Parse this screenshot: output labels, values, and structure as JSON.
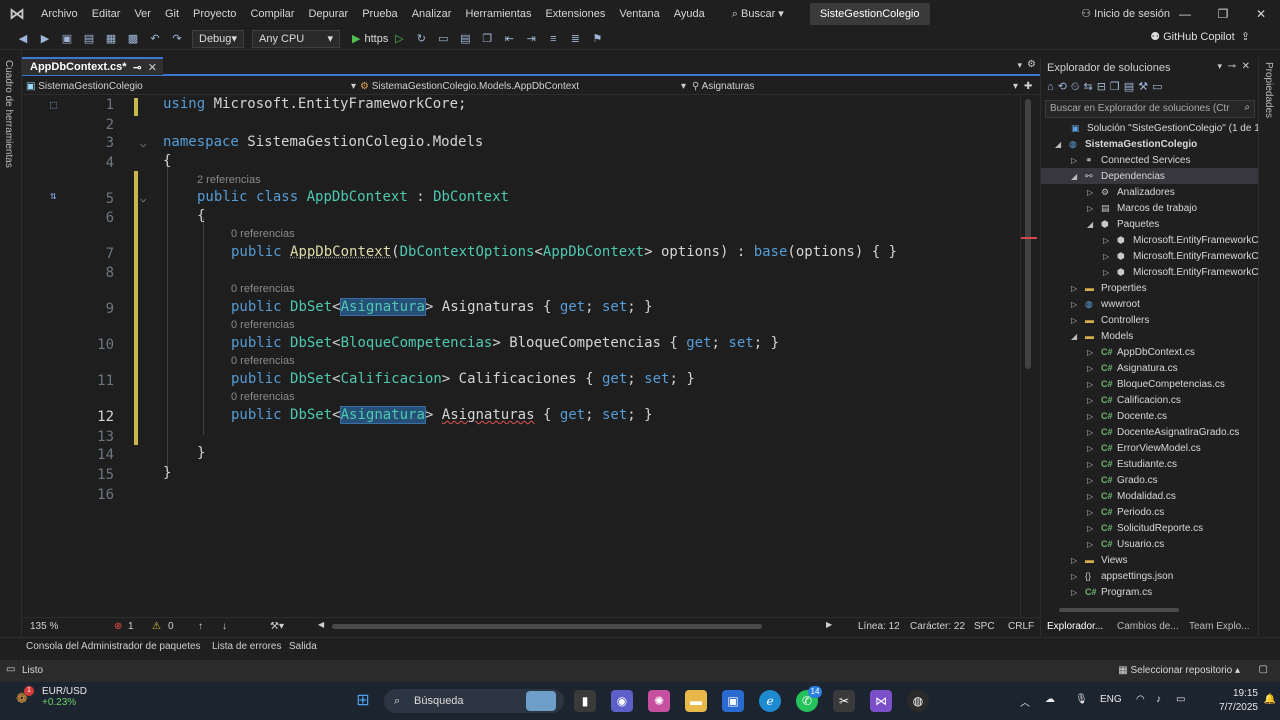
{
  "menu": {
    "items": [
      "Archivo",
      "Editar",
      "Ver",
      "Git",
      "Proyecto",
      "Compilar",
      "Depurar",
      "Prueba",
      "Analizar",
      "Herramientas",
      "Extensiones",
      "Ventana",
      "Ayuda"
    ],
    "search_label": "Buscar",
    "solution_title": "SisteGestionColegio",
    "login_label": "Inicio de sesión"
  },
  "toolbar": {
    "config": "Debug",
    "platform": "Any CPU",
    "run_target": "https",
    "copilot_label": "GitHub Copilot"
  },
  "left_strip": {
    "label": "Cuadro de herramientas"
  },
  "right_strip": {
    "label": "Propiedades"
  },
  "editor_tab": {
    "label": "AppDbContext.cs*"
  },
  "navbar": {
    "project": "SistemaGestionColegio",
    "type": "SistemaGestionColegio.Models.AppDbContext",
    "member": "Asignaturas"
  },
  "code": {
    "line_numbers": [
      "1",
      "2",
      "3",
      "4",
      "5",
      "6",
      "7",
      "8",
      "9",
      "10",
      "11",
      "12",
      "13",
      "14",
      "15",
      "16"
    ],
    "current_line": "12",
    "refs": {
      "class_refs": "2 referencias",
      "ctor_refs": "0 referencias",
      "p1_refs": "0 referencias",
      "p2_refs": "0 referencias",
      "p3_refs": "0 referencias",
      "p4_refs": "0 referencias"
    },
    "tokens": {
      "using": "using",
      "using_ns": "Microsoft.EntityFrameworkCore;",
      "namespace": "namespace",
      "ns_name": "SistemaGestionColegio.Models",
      "open_brace": "{",
      "close_brace": "}",
      "public": "public",
      "class": "class",
      "class_name": "AppDbContext",
      "colon": ":",
      "base_class": "DbContext",
      "ctor_name": "AppDbContext",
      "ctor_paren_open": "(",
      "options_type": "DbContextOptions",
      "lt": "<",
      "gt": ">",
      "options_param": "options)",
      "base_kw": "base",
      "base_call": "(options) { }",
      "dbset": "DbSet",
      "asignatura": "Asignatura",
      "asignaturas": "Asignaturas",
      "bloque": "BloqueCompetencias",
      "calificacion": "Calificacion",
      "calificaciones": "Calificaciones",
      "acc_open": "{",
      "get": "get",
      "set": "set",
      "semi": ";",
      "acc_close": "}"
    }
  },
  "editor_status": {
    "zoom": "135 %",
    "errors": "1",
    "warnings": "0",
    "line": "Línea: 12",
    "char": "Carácter: 22",
    "spc": "SPC",
    "crlf": "CRLF"
  },
  "solution_explorer": {
    "title": "Explorador de soluciones",
    "search_placeholder": "Buscar en Explorador de soluciones (Ctr",
    "items": [
      {
        "label": "Solución \"SisteGestionColegio\" (1 de 1 p",
        "level": 0,
        "exp": "",
        "icon": "solution",
        "sel": false,
        "bold": false
      },
      {
        "label": "SistemaGestionColegio",
        "level": 0,
        "exp": "◢",
        "icon": "web-project",
        "sel": false,
        "bold": true
      },
      {
        "label": "Connected Services",
        "level": 1,
        "exp": "▷",
        "icon": "connected",
        "sel": false,
        "bold": false
      },
      {
        "label": "Dependencias",
        "level": 1,
        "exp": "◢",
        "icon": "dependencies",
        "sel": true,
        "bold": false
      },
      {
        "label": "Analizadores",
        "level": 2,
        "exp": "▷",
        "icon": "analyzer",
        "sel": false,
        "bold": false
      },
      {
        "label": "Marcos de trabajo",
        "level": 2,
        "exp": "▷",
        "icon": "framework",
        "sel": false,
        "bold": false
      },
      {
        "label": "Paquetes",
        "level": 2,
        "exp": "◢",
        "icon": "package",
        "sel": false,
        "bold": false
      },
      {
        "label": "Microsoft.EntityFrameworkC",
        "level": 3,
        "exp": "▷",
        "icon": "package",
        "sel": false,
        "bold": false
      },
      {
        "label": "Microsoft.EntityFrameworkC",
        "level": 3,
        "exp": "▷",
        "icon": "package",
        "sel": false,
        "bold": false
      },
      {
        "label": "Microsoft.EntityFrameworkC",
        "level": 3,
        "exp": "▷",
        "icon": "package",
        "sel": false,
        "bold": false
      },
      {
        "label": "Properties",
        "level": 1,
        "exp": "▷",
        "icon": "folder",
        "sel": false,
        "bold": false
      },
      {
        "label": "wwwroot",
        "level": 1,
        "exp": "▷",
        "icon": "web",
        "sel": false,
        "bold": false
      },
      {
        "label": "Controllers",
        "level": 1,
        "exp": "▷",
        "icon": "folder",
        "sel": false,
        "bold": false
      },
      {
        "label": "Models",
        "level": 1,
        "exp": "◢",
        "icon": "folder",
        "sel": false,
        "bold": false
      },
      {
        "label": "AppDbContext.cs",
        "level": 2,
        "exp": "▷",
        "icon": "cs",
        "sel": false,
        "bold": false
      },
      {
        "label": "Asignatura.cs",
        "level": 2,
        "exp": "▷",
        "icon": "cs",
        "sel": false,
        "bold": false
      },
      {
        "label": "BloqueCompetencias.cs",
        "level": 2,
        "exp": "▷",
        "icon": "cs",
        "sel": false,
        "bold": false
      },
      {
        "label": "Calificacion.cs",
        "level": 2,
        "exp": "▷",
        "icon": "cs",
        "sel": false,
        "bold": false
      },
      {
        "label": "Docente.cs",
        "level": 2,
        "exp": "▷",
        "icon": "cs",
        "sel": false,
        "bold": false
      },
      {
        "label": "DocenteAsignatiraGrado.cs",
        "level": 2,
        "exp": "▷",
        "icon": "cs",
        "sel": false,
        "bold": false
      },
      {
        "label": "ErrorViewModel.cs",
        "level": 2,
        "exp": "▷",
        "icon": "cs",
        "sel": false,
        "bold": false
      },
      {
        "label": "Estudiante.cs",
        "level": 2,
        "exp": "▷",
        "icon": "cs",
        "sel": false,
        "bold": false
      },
      {
        "label": "Grado.cs",
        "level": 2,
        "exp": "▷",
        "icon": "cs",
        "sel": false,
        "bold": false
      },
      {
        "label": "Modalidad.cs",
        "level": 2,
        "exp": "▷",
        "icon": "cs",
        "sel": false,
        "bold": false
      },
      {
        "label": "Periodo.cs",
        "level": 2,
        "exp": "▷",
        "icon": "cs",
        "sel": false,
        "bold": false
      },
      {
        "label": "SolicitudReporte.cs",
        "level": 2,
        "exp": "▷",
        "icon": "cs",
        "sel": false,
        "bold": false
      },
      {
        "label": "Usuario.cs",
        "level": 2,
        "exp": "▷",
        "icon": "cs",
        "sel": false,
        "bold": false
      },
      {
        "label": "Views",
        "level": 1,
        "exp": "▷",
        "icon": "folder",
        "sel": false,
        "bold": false
      },
      {
        "label": "appsettings.json",
        "level": 1,
        "exp": "▷",
        "icon": "json",
        "sel": false,
        "bold": false
      },
      {
        "label": "Program.cs",
        "level": 1,
        "exp": "▷",
        "icon": "cs",
        "sel": false,
        "bold": false
      }
    ],
    "bottom_tabs": [
      "Explorador...",
      "Cambios de...",
      "Team Explo..."
    ]
  },
  "bottom_tabs": [
    "Consola del Administrador de paquetes",
    "Lista de errores",
    "Salida"
  ],
  "status": {
    "ready": "Listo",
    "repo": "Seleccionar repositorio"
  },
  "taskbar": {
    "ticker": "EUR/USD",
    "ticker_change": "+0.23%",
    "ticker_badge": "1",
    "search_label": "Búsqueda",
    "whatsapp_badge": "14",
    "lang": "ENG",
    "time": "19:15",
    "date": "7/7/2025"
  },
  "colors": {
    "accent": "#3b78d6",
    "keyword": "#569cd6",
    "type": "#4ec9b0",
    "method": "#dcdcaa",
    "csharp_icon": "#6fb56f",
    "folder_icon": "#d8b04c"
  }
}
